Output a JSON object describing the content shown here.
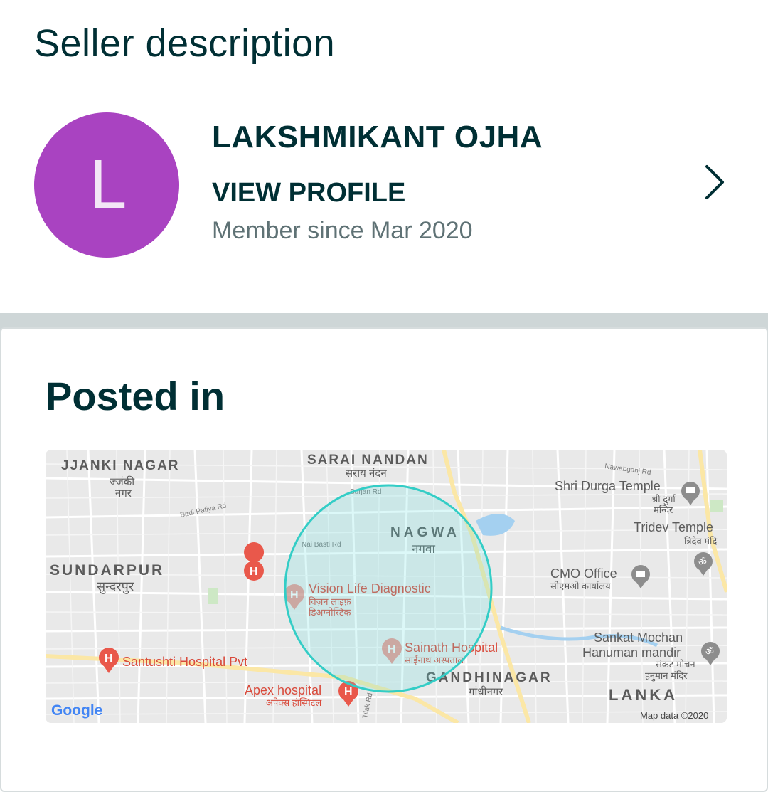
{
  "seller": {
    "section_title": "Seller description",
    "avatar_letter": "L",
    "avatar_color": "#a943c1",
    "name": "LAKSHMIKANT OJHA",
    "view_profile": "VIEW PROFILE",
    "member_since": "Member since Mar 2020"
  },
  "posted_in": {
    "title": "Posted in"
  },
  "map": {
    "labels": {
      "jjanki_nagar": "JJANKI NAGAR",
      "jjanki_hi_1": "ज्जंकी",
      "jjanki_hi_2": "नगर",
      "sarai_nandan": "SARAI NANDAN",
      "sarai_hi": "सराय नंदन",
      "nawabganj": "Nawabganj Rd",
      "shri_durga": "Shri Durga Temple",
      "durga_hi_1": "श्री दुर्गा",
      "durga_hi_2": "मन्दिर",
      "tridev": "Tridev Temple",
      "tridev_hi": "त्रिदेव मंदि",
      "badi_patiya": "Badi Patiya Rd",
      "surjan": "Surjan Rd",
      "nai_basti": "Nai Basti Rd",
      "nagwa": "NAGWA",
      "nagwa_hi": "नगवा",
      "sundarpur": "SUNDARPUR",
      "sundarpur_hi": "सुन्दरपुर",
      "cmo": "CMO Office",
      "cmo_hi": "सीएमओ कार्यालय",
      "vision": "Vision Life Diagnostic",
      "vision_hi_1": "विज़न लाइफ़",
      "vision_hi_2": "डिअग्नोस्टिक",
      "sankat": "Sankat Mochan",
      "hanuman": "Hanuman mandir",
      "sankat_hi_1": "संकट मोचन",
      "sankat_hi_2": "हनुमान मंदिर",
      "santushti": "Santushti Hospital Pvt",
      "sainath": "Sainath Hospital",
      "sainath_hi": "साईनाथ अस्पताल",
      "gandhinagar": "GANDHINAGAR",
      "gandhinagar_hi": "गांधीनगर",
      "apex": "Apex hospital",
      "apex_hi": "अपेक्स हॉस्पिटल",
      "lanka": "LANKA",
      "tilak": "Tilak Rd",
      "google": "Google",
      "map_data": "Map data ©2020"
    }
  }
}
